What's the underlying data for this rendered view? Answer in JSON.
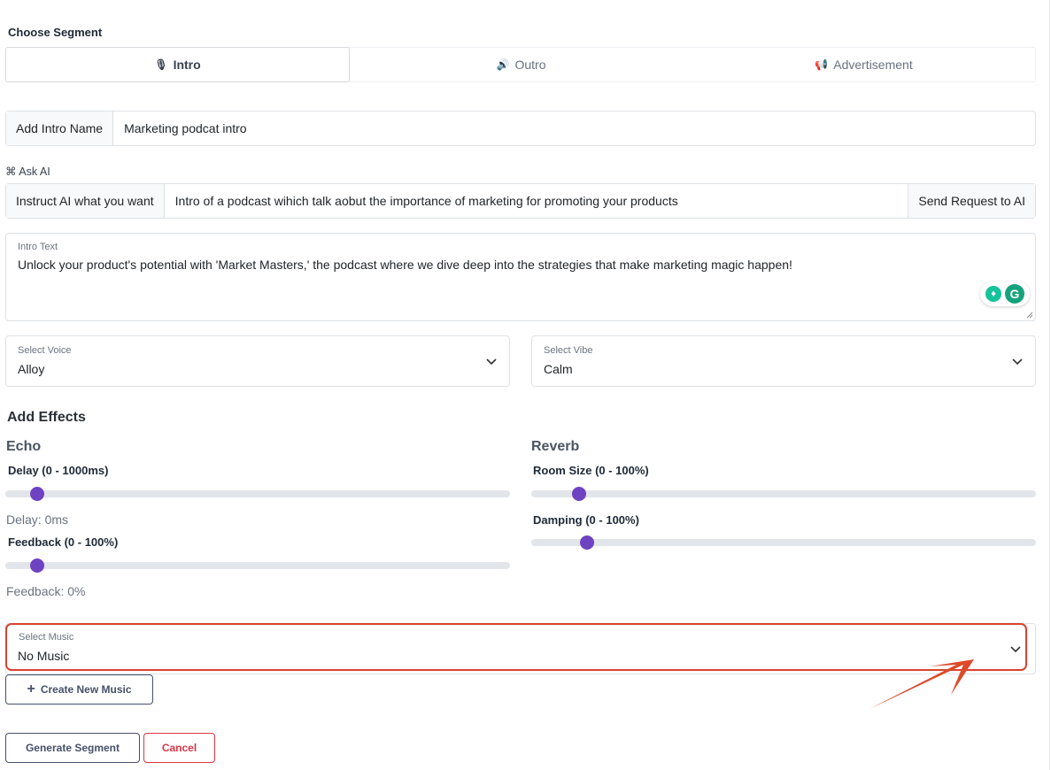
{
  "segment": {
    "label": "Choose Segment",
    "tabs": [
      {
        "icon": "microphone-icon",
        "label": "Intro",
        "active": true
      },
      {
        "icon": "speaker-icon",
        "label": "Outro",
        "active": false
      },
      {
        "icon": "megaphone-icon",
        "label": "Advertisement",
        "active": false
      }
    ]
  },
  "name_field": {
    "addon": "Add Intro Name",
    "value": "Marketing podcat intro"
  },
  "ask_ai": {
    "label": "⌘ Ask AI",
    "addon": "Instruct AI what you want",
    "value": "Intro of a podcast wihich talk aobut the importance of marketing for promoting your products",
    "button": "Send Request to AI"
  },
  "intro_text": {
    "label": "Intro Text",
    "value": "Unlock your product's potential with 'Market Masters,' the podcast where we dive deep into the strategies that make marketing magic happen!"
  },
  "voice": {
    "label": "Select Voice",
    "value": "Alloy"
  },
  "vibe": {
    "label": "Select Vibe",
    "value": "Calm"
  },
  "effects": {
    "title": "Add Effects",
    "echo": {
      "title": "Echo",
      "delay_label": "Delay (0 - 1000ms)",
      "delay_value": 0,
      "delay_readout": "Delay: 0ms",
      "feedback_label": "Feedback (0 - 100%)",
      "feedback_value": 0,
      "feedback_readout": "Feedback: 0%"
    },
    "reverb": {
      "title": "Reverb",
      "room_label": "Room Size (0 - 100%)",
      "room_value": 5,
      "damping_label": "Damping (0 - 100%)",
      "damping_value": 6
    }
  },
  "music": {
    "label": "Select Music",
    "value": "No Music"
  },
  "buttons": {
    "create_music": "Create New Music",
    "generate": "Generate Segment",
    "cancel": "Cancel"
  },
  "colors": {
    "accent": "#6f42c1",
    "highlight": "#d9432e",
    "danger": "#dc3545"
  }
}
